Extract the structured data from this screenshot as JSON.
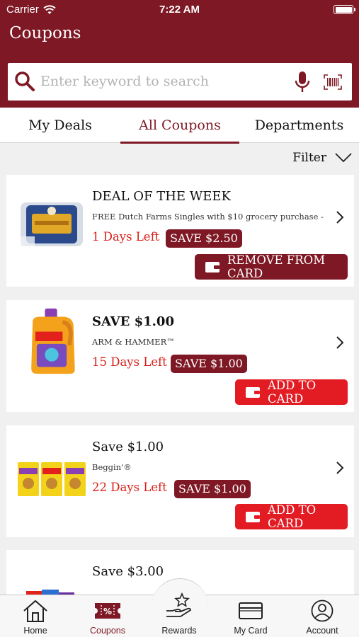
{
  "status_bar": {
    "carrier": "Carrier",
    "time": "7:22 AM"
  },
  "header": {
    "title": "Coupons"
  },
  "search": {
    "placeholder": "Enter keyword to search"
  },
  "tabs": [
    {
      "label": "My Deals",
      "active": false
    },
    {
      "label": "All Coupons",
      "active": true
    },
    {
      "label": "Departments",
      "active": false
    }
  ],
  "filter": {
    "label": "Filter"
  },
  "coupons": [
    {
      "title": "DEAL OF THE WEEK",
      "description": "FREE Dutch Farms Singles with $10 grocery purchase -",
      "days_left": "1 Days Left",
      "save": "SAVE $2.50",
      "action": "REMOVE FROM CARD"
    },
    {
      "title": "SAVE $1.00",
      "description": "ARM & HAMMER™",
      "days_left": "15 Days Left",
      "save": "SAVE $1.00",
      "action": "ADD TO CARD"
    },
    {
      "title": "Save $1.00",
      "description": "Beggin'®",
      "days_left": "22 Days Left",
      "save": "SAVE $1.00",
      "action": "ADD TO CARD"
    },
    {
      "title": "Save $3.00",
      "description": "",
      "days_left": "",
      "save": "",
      "action": ""
    }
  ],
  "bottom_nav": [
    {
      "label": "Home",
      "icon": "home-icon",
      "active": false
    },
    {
      "label": "Coupons",
      "icon": "coupon-ticket-icon",
      "active": true
    },
    {
      "label": "Rewards",
      "icon": "rewards-hand-star-icon",
      "active": false
    },
    {
      "label": "My Card",
      "icon": "card-icon",
      "active": false
    },
    {
      "label": "Account",
      "icon": "account-icon",
      "active": false
    }
  ],
  "colors": {
    "brand": "#7e1824",
    "accent_red": "#e31b23",
    "days_left": "#d8211b",
    "background": "#f0f0f0"
  }
}
